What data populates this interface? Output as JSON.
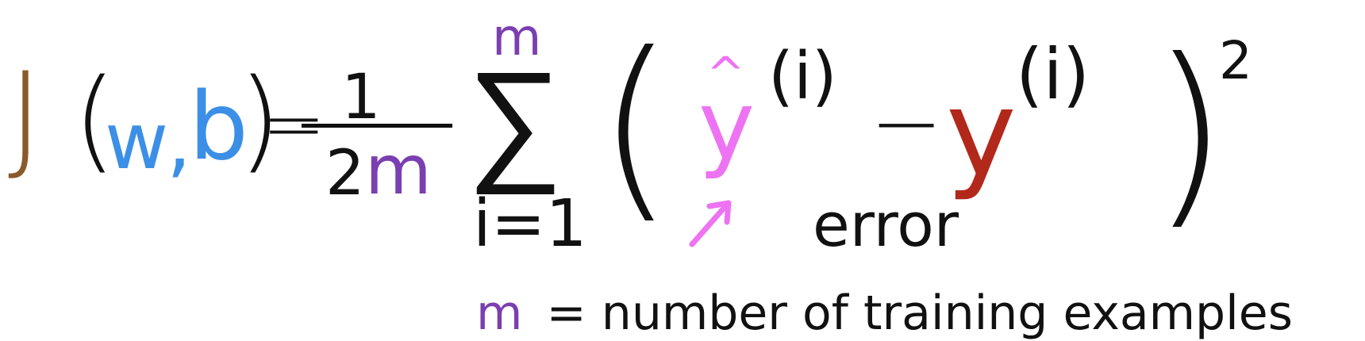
{
  "formula": {
    "J": "J",
    "open_paren": "(",
    "w": "w",
    "comma": ",",
    "b": "b",
    "close_paren": ")",
    "equals": "=",
    "numerator": "1",
    "denominator_two": "2",
    "denominator_m": "m",
    "sum_symbol": "∑",
    "sum_upper": "m",
    "sum_lower": "i=1",
    "big_open": "(",
    "yhat": "y",
    "hat": "^",
    "superscript_1": "(i)",
    "minus": "−",
    "y": "y",
    "superscript_2": "(i)",
    "big_close": ")",
    "square": "2",
    "error_label": "error"
  },
  "footnote": {
    "symbol": "m",
    "text": "= number of training examples"
  },
  "colors": {
    "J": "#8a5a2b",
    "wb": "#3c8fe6",
    "m": "#7a3fb0",
    "yhat": "#ee73f2",
    "y": "#b2281b",
    "ink": "#111111"
  }
}
